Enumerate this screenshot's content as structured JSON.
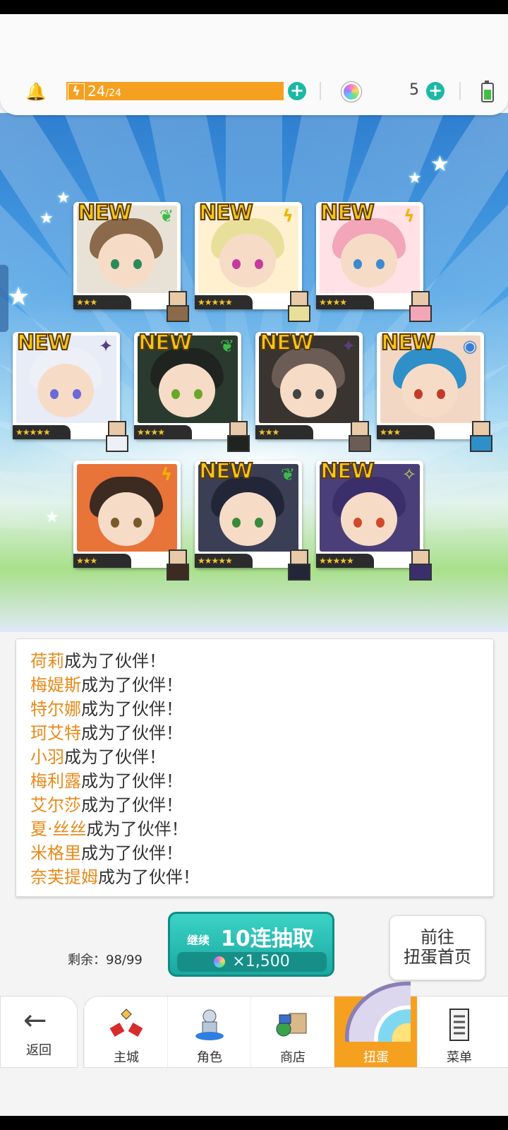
{
  "status": {
    "energy": "24",
    "energy_max": "/24",
    "gems": "5"
  },
  "cards": [
    {
      "new": "NEW",
      "stars": "★★★",
      "element": "leaf"
    },
    {
      "new": "NEW",
      "stars": "★★★★★",
      "element": "lightning"
    },
    {
      "new": "NEW",
      "stars": "★★★★",
      "element": "lightning"
    },
    {
      "new": "NEW",
      "stars": "★★★★★",
      "element": "dark"
    },
    {
      "new": "NEW",
      "stars": "★★★★",
      "element": "leaf"
    },
    {
      "new": "NEW",
      "stars": "★★★",
      "element": "dark"
    },
    {
      "new": "NEW",
      "stars": "★★★",
      "element": "water"
    },
    {
      "new": "",
      "stars": "★★★",
      "element": "lightning"
    },
    {
      "new": "NEW",
      "stars": "★★★★★",
      "element": "leaf"
    },
    {
      "new": "NEW",
      "stars": "★★★★★",
      "element": "light"
    }
  ],
  "log": {
    "suffix": "成为了伙伴！",
    "names": [
      "荷莉",
      "梅媞斯",
      "特尔娜",
      "珂艾特",
      "小羽",
      "梅利露",
      "艾尔莎",
      "夏·丝丝",
      "米格里",
      "奈芙提姆"
    ]
  },
  "remaining": "剩余：98/99",
  "pull_button": {
    "sub": "继续",
    "main": "10连抽取",
    "cost": "×1,500"
  },
  "home_button": {
    "line1": "前往",
    "line2": "扭蛋首页"
  },
  "nav": {
    "back": "返回",
    "tabs": [
      "主城",
      "角色",
      "商店",
      "扭蛋",
      "菜单"
    ]
  },
  "colors": {
    "accent": "#f6a020",
    "teal": "#1ab9a6",
    "name": "#e88a1a"
  }
}
